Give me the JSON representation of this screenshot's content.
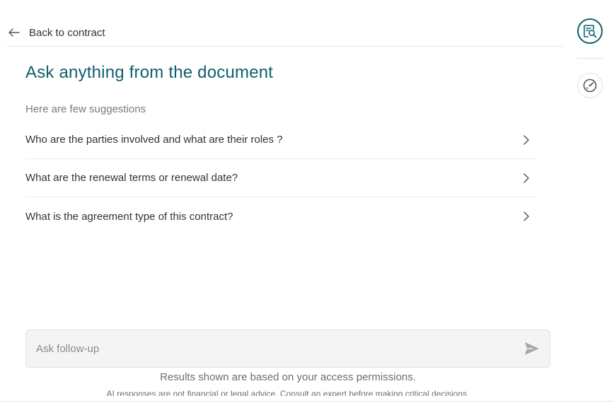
{
  "nav": {
    "back_label": "Back to contract"
  },
  "main": {
    "title": "Ask anything from the document",
    "suggestions_heading": "Here are few suggestions",
    "suggestions": [
      {
        "label": "Who are the parties involved and what are their roles ?"
      },
      {
        "label": "What are the renewal terms or renewal date?"
      },
      {
        "label": "What is the agreement type of this contract?"
      }
    ]
  },
  "composer": {
    "placeholder": "Ask follow-up",
    "value": ""
  },
  "footer": {
    "permissions_note": "Results shown are based on your access permissions.",
    "disclaimer": "AI responses are not financial or legal advice. Consult an expert before making critical decisions."
  },
  "rail": {
    "items": [
      {
        "icon": "document-search-icon",
        "active": true
      },
      {
        "icon": "speedometer-icon",
        "active": false
      }
    ]
  },
  "colors": {
    "accent": "#0e5f6b",
    "text": "#333333",
    "muted": "#7a7a7a",
    "input_bg": "#f4f4f4"
  }
}
